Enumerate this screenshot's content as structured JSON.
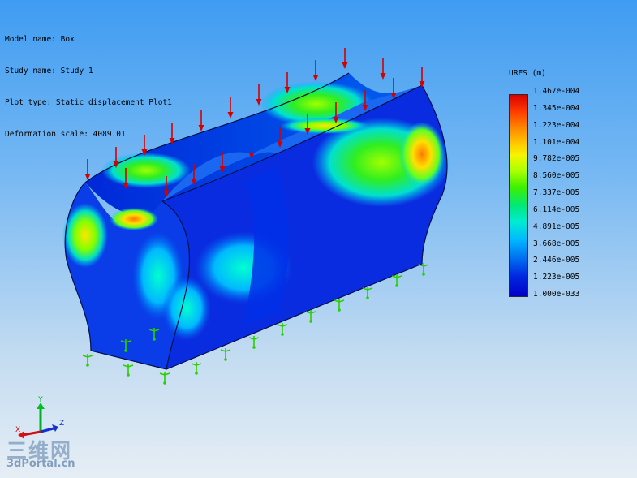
{
  "info": {
    "model_name": "Model name: Box",
    "study_name": "Study name: Study 1",
    "plot_type": "Plot type: Static displacement Plot1",
    "deformation_scale": "Deformation scale: 4089.01"
  },
  "legend": {
    "title": "URES (m)",
    "ticks": [
      "1.467e-004",
      "1.345e-004",
      "1.223e-004",
      "1.101e-004",
      "9.782e-005",
      "8.560e-005",
      "7.337e-005",
      "6.114e-005",
      "4.891e-005",
      "3.668e-005",
      "2.446e-005",
      "1.223e-005",
      "1.000e-033"
    ],
    "colors": {
      "max": "#d80000",
      "mid": "#3cf000",
      "min": "#0000c8"
    }
  },
  "triad": {
    "x": "X",
    "y": "Y",
    "z": "Z"
  },
  "watermark": {
    "chinese": "三维网",
    "english": "3dPortal.cn"
  },
  "colors": {
    "load_arrow": "#d40000",
    "fixture": "#28d000",
    "background_top": "#3f9cf2",
    "background_bottom": "#e6eef5"
  }
}
